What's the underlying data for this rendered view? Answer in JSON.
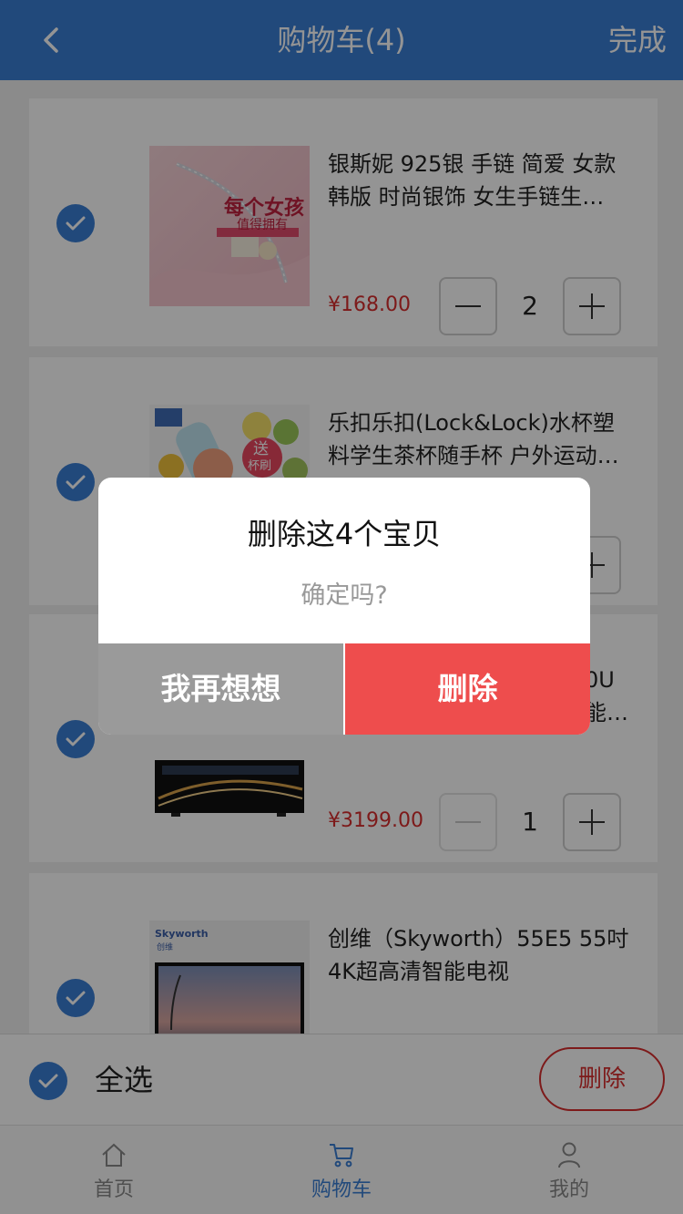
{
  "navbar": {
    "title": "购物车(4)",
    "done_label": "完成"
  },
  "cart": {
    "items": [
      {
        "title": "银斯妮 925银 手链 简爱 女款 韩版 时尚银饰 女生手链生…",
        "price": "¥168.00",
        "quantity": "2",
        "thumb_text": "每个女孩",
        "thumb_subtext": "值得拥有"
      },
      {
        "title": "乐扣乐扣(Lock&Lock)水杯塑料学生茶杯随手杯 户外运动…",
        "price": "",
        "quantity": "",
        "thumb_text": "送",
        "thumb_subtext": "杯刷"
      },
      {
        "title": "0U 能…",
        "price": "¥3199.00",
        "quantity": "1"
      },
      {
        "title": "创维（Skyworth）55E5 55吋 4K超高清智能电视",
        "price": "",
        "quantity": "",
        "thumb_text": "Skyworth",
        "thumb_subtext": "创维"
      }
    ]
  },
  "footer": {
    "select_all_label": "全选",
    "delete_label": "删除"
  },
  "tabs": [
    {
      "label": "首页",
      "icon": "home-icon"
    },
    {
      "label": "购物车",
      "icon": "cart-icon",
      "active": true
    },
    {
      "label": "我的",
      "icon": "user-icon"
    }
  ],
  "dialog": {
    "title": "删除这4个宝贝",
    "message": "确定吗?",
    "cancel_label": "我再想想",
    "confirm_label": "删除"
  },
  "colors": {
    "primary": "#3a7ed4",
    "danger": "#ee4d4d",
    "price": "#d82e2e"
  }
}
